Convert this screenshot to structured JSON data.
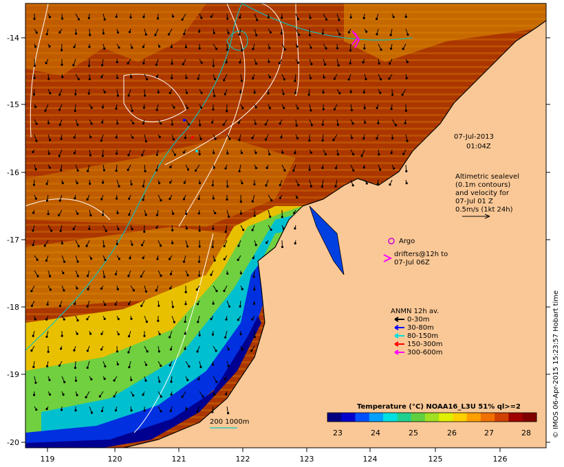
{
  "map": {
    "x_ticks": [
      "119",
      "120",
      "121",
      "122",
      "123",
      "124",
      "125",
      "126"
    ],
    "y_ticks": [
      "-14",
      "-15",
      "-16",
      "-17",
      "-18",
      "-19",
      "-20"
    ]
  },
  "timestamp": {
    "date": "07-Jul-2013",
    "time": "01:04Z"
  },
  "altimetry": {
    "lines": [
      "Altimetric sealevel",
      "(0.1m contours)",
      "and velocity for",
      "07-Jul 01 Z",
      "0.5m/s (1kt 24h)"
    ]
  },
  "argo": {
    "label": "Argo"
  },
  "drifters": {
    "lines": [
      "drifters@12h to",
      "07-Jul 06Z"
    ]
  },
  "anmn": {
    "title": "ANMN 12h av.",
    "items": [
      {
        "label": "0-30m",
        "color": "#000000"
      },
      {
        "label": "30-80m",
        "color": "#0000ff"
      },
      {
        "label": "80-150m",
        "color": "#00e0e0"
      },
      {
        "label": "150-300m",
        "color": "#ff0000"
      },
      {
        "label": "300-600m",
        "color": "#ff00ff"
      }
    ]
  },
  "bathy": {
    "label": "200 1000m"
  },
  "colorbar": {
    "title": "Temperature (°C) NOAA16_L3U 51% ql>=2",
    "ticks": [
      "23",
      "24",
      "25",
      "26",
      "27",
      "28"
    ],
    "colors": [
      "#000080",
      "#0000cd",
      "#0050ff",
      "#00a0ff",
      "#00e0e0",
      "#20d090",
      "#60d040",
      "#a0e020",
      "#e0f000",
      "#ffd000",
      "#ffa000",
      "#f07000",
      "#d04000",
      "#a00000",
      "#800000"
    ]
  },
  "credit": {
    "text": "© IMOS 06-Apr-2015 15:23:57 Hobart time"
  },
  "colors": {
    "land": "#fac896",
    "warm_sea": "#b03000",
    "frame": "#000000"
  }
}
